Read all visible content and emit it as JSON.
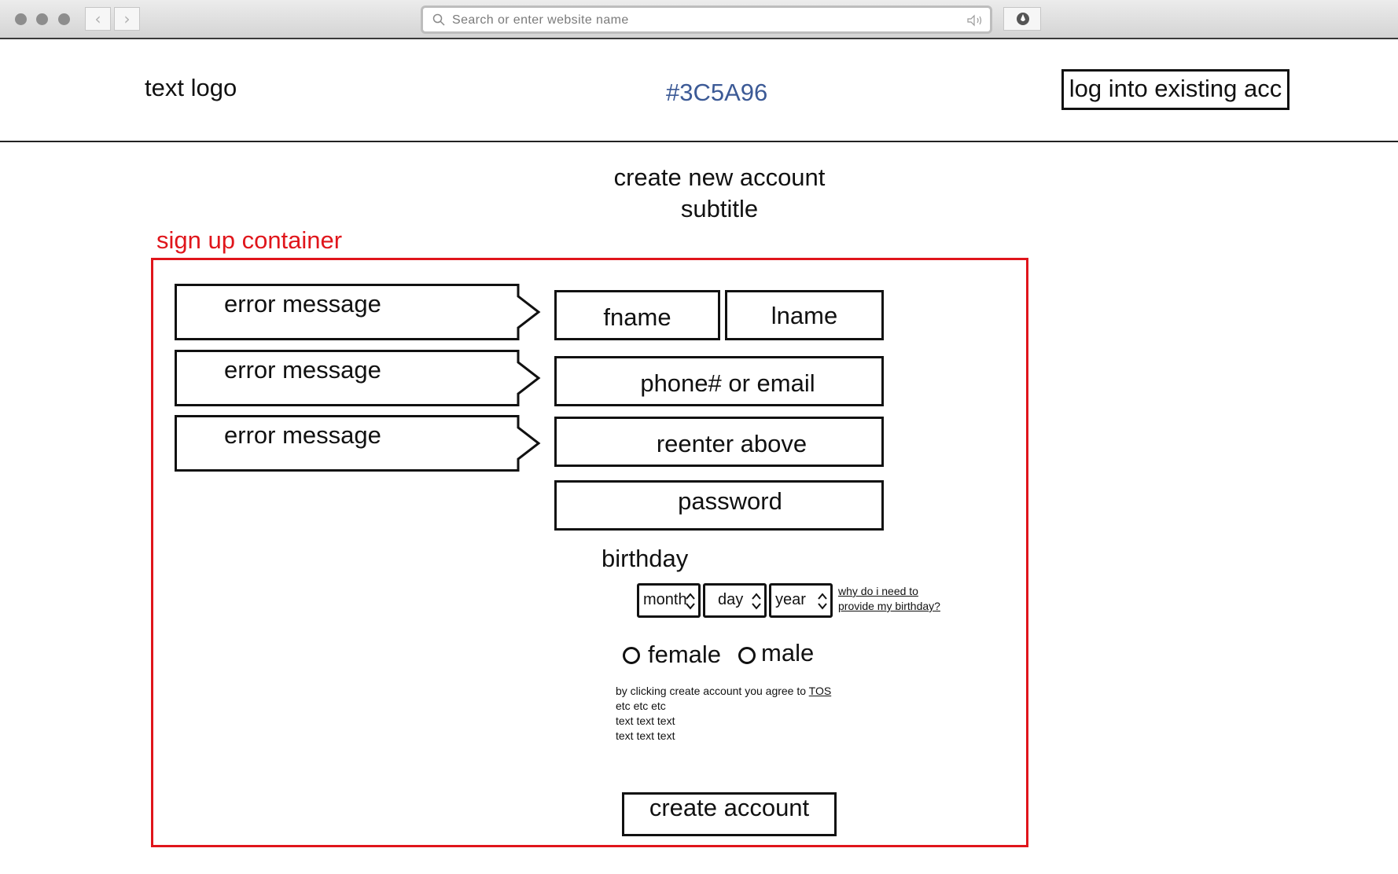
{
  "browser": {
    "address_placeholder": "Search or enter website name",
    "back_glyph": "‹",
    "forward_glyph": "›"
  },
  "header": {
    "logo": "text logo",
    "brand_color_label": "#3C5A96",
    "login_label": "log into existing acc"
  },
  "page": {
    "title": "create new account",
    "subtitle": "subtitle",
    "container_annotation": "sign up container"
  },
  "errors": [
    "error message",
    "error message",
    "error message"
  ],
  "form": {
    "fname": "fname",
    "lname": "lname",
    "contact": "phone# or email",
    "reenter": "reenter above",
    "password": "password",
    "birthday_label": "birthday",
    "month": "month",
    "day": "day",
    "year": "year",
    "birthday_help": "why do i need to provide my birthday?",
    "gender_female": "female",
    "gender_male": "male",
    "terms_prefix": "by clicking create account you agree to ",
    "terms_link": "TOS",
    "terms_lines": [
      "etc etc etc",
      "text text text",
      "text text text"
    ],
    "submit": "create account"
  },
  "colors": {
    "brand": "#3C5A96",
    "annotation": "#e0151b",
    "outline": "#111111"
  },
  "icons": [
    "search-icon",
    "audio-icon",
    "extension-icon",
    "back-arrow-icon",
    "forward-arrow-icon",
    "updown-chevron-icon"
  ]
}
